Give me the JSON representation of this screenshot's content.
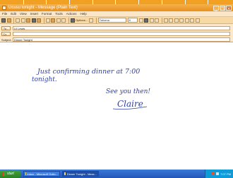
{
  "window": {
    "title": "Ucusu tonight - Message (Plain Text)",
    "controls": [
      "_",
      "□",
      "×"
    ]
  },
  "menu": [
    "File",
    "Edit",
    "View",
    "Insert",
    "Format",
    "Tools",
    "Actions",
    "Help"
  ],
  "toolbar": {
    "send_label": "Send",
    "options_label": "Options...",
    "font_name": "Tahoma",
    "font_size": "8"
  },
  "headers": {
    "to_label": "To...",
    "to_value": "Lil Lewis",
    "cc_label": "Cc...",
    "cc_value": "",
    "subject_label": "Subject:",
    "subject_value": "Dinner Tonight"
  },
  "body": {
    "handwriting_line1": "Just confirming dinner at 7:00",
    "handwriting_line2": "tonight.",
    "handwriting_line3": "See you then!",
    "signature": "Claire",
    "ink_color": "#2f3fa8"
  },
  "taskbar": {
    "start_label": "start",
    "tasks": [
      {
        "label": "Inbox - Microsoft Outlo..."
      },
      {
        "label": "Dinner Tonight - Mess..."
      }
    ],
    "clock": "7:07 PM"
  }
}
